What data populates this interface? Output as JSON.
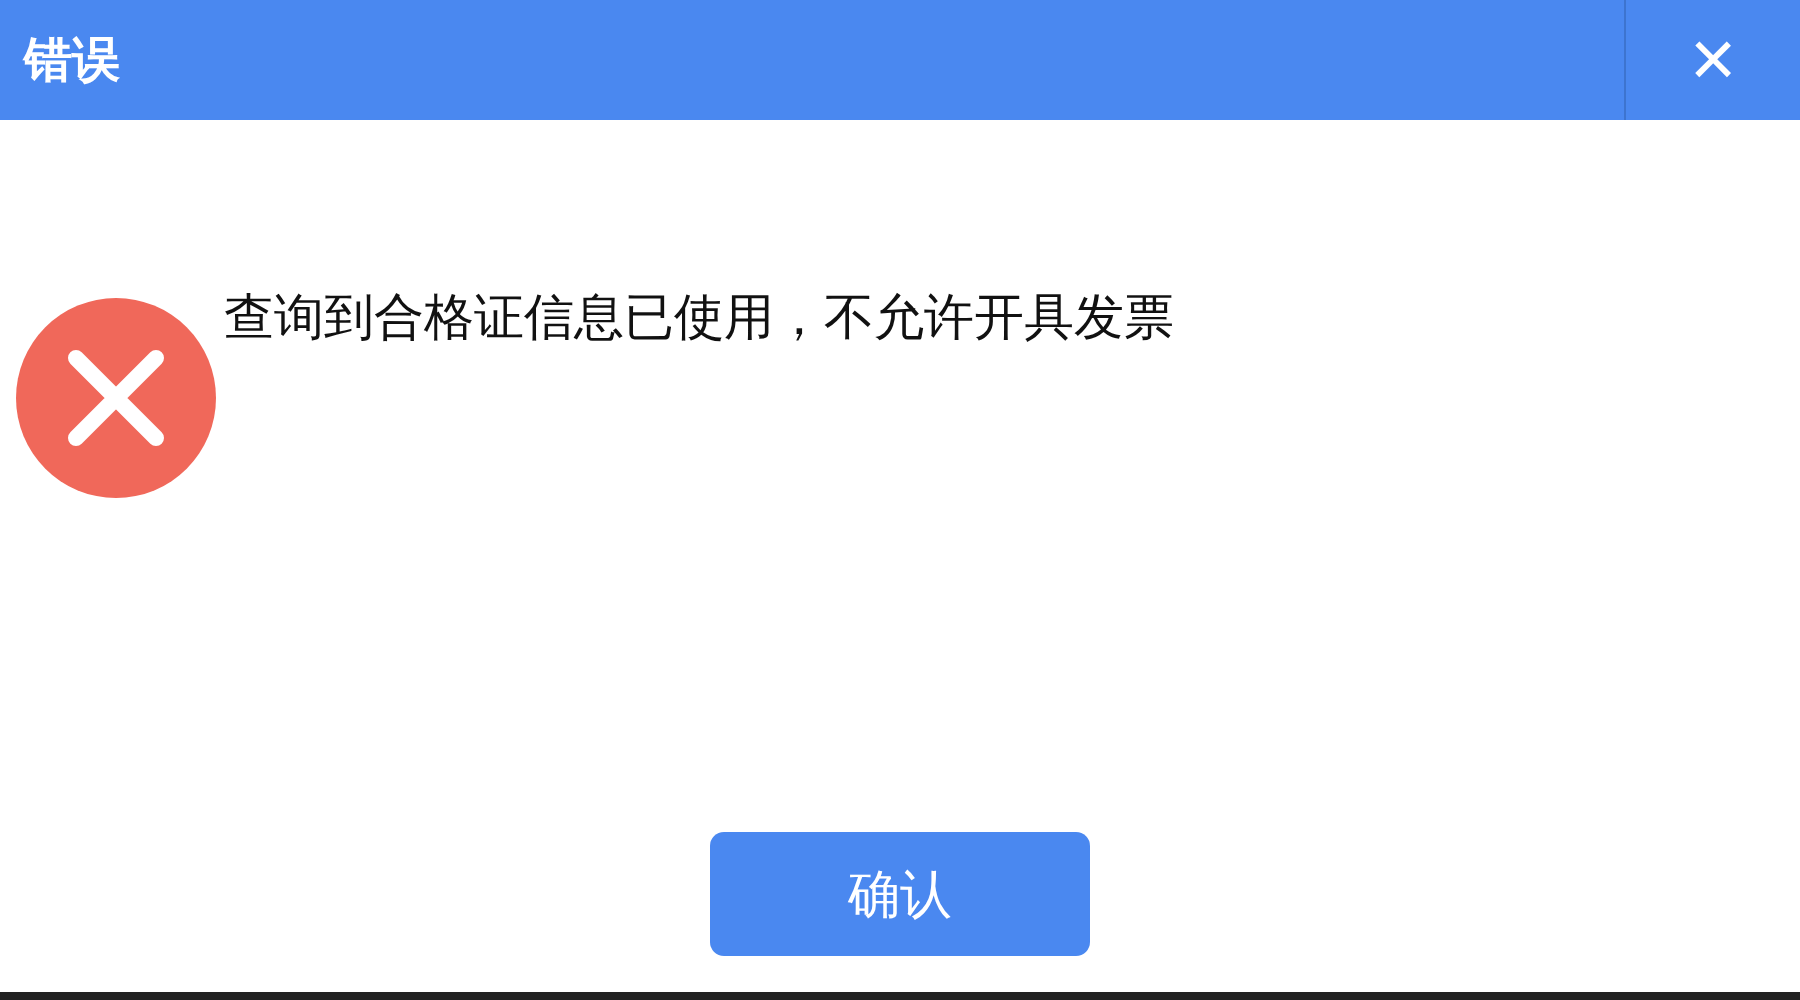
{
  "window": {
    "title": "错误",
    "close": "×"
  },
  "message": "查询到合格证信息已使用，不允许开具发票",
  "buttons": [
    "确认"
  ]
}
